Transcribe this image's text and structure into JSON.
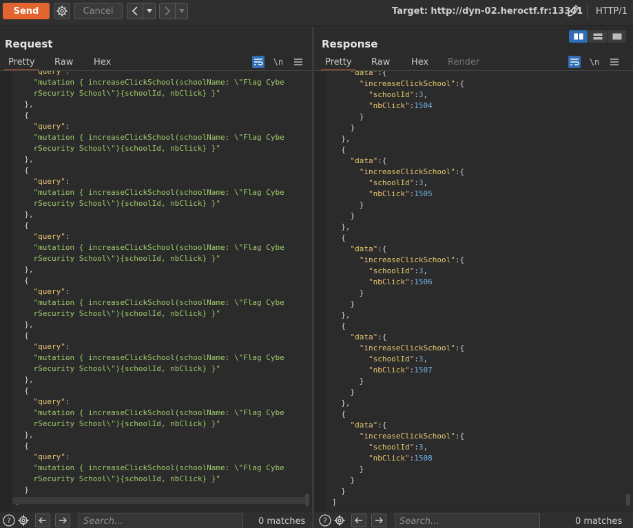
{
  "toolbar": {
    "send_label": "Send",
    "cancel_label": "Cancel",
    "target_label": "Target: http://dyn-02.heroctf.fr:13341",
    "protocol_label": "HTTP/1"
  },
  "request": {
    "title": "Request",
    "tabs": [
      {
        "label": "Pretty"
      },
      {
        "label": "Raw"
      },
      {
        "label": "Hex"
      }
    ],
    "newline_label": "\\n"
  },
  "response": {
    "title": "Response",
    "tabs": [
      {
        "label": "Pretty"
      },
      {
        "label": "Raw"
      },
      {
        "label": "Hex"
      },
      {
        "label": "Render"
      }
    ],
    "newline_label": "\\n"
  },
  "request_body": {
    "key": "\"query\"",
    "line1": "\"mutation { increaseClickSchool(schoolName: \\\"Flag Cybe",
    "line2": "rSecurity School\\\"){schoolId, nbClick} }\"",
    "top_fragment": "\"query\":"
  },
  "response_body": {
    "data_key": "\"data\"",
    "inner_key": "\"increaseClickSchool\"",
    "school_key": "\"schoolId\"",
    "school_value": "3",
    "click_key": "\"nbClick\"",
    "top_click_value": "1504",
    "click_values": [
      "1505",
      "1506",
      "1507",
      "1508"
    ]
  },
  "search": {
    "placeholder": "Search...",
    "left_matches": "0 matches",
    "right_matches": "0 matches"
  },
  "colors": {
    "accent": "#e3642f",
    "active_blue": "#2f6db5"
  }
}
